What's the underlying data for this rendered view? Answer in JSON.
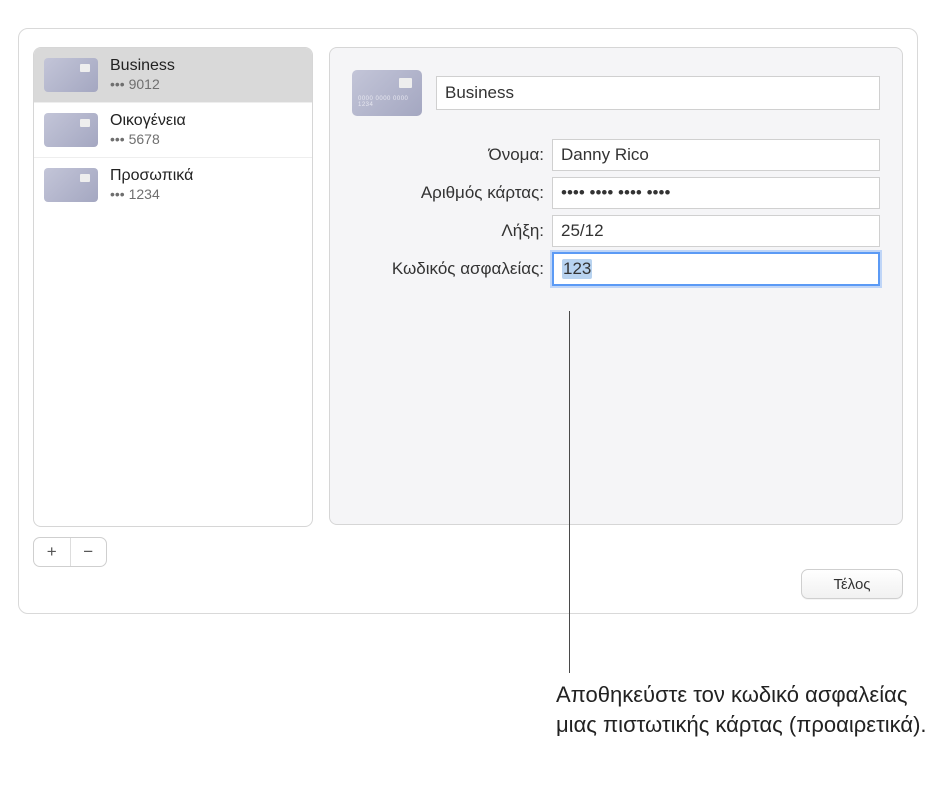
{
  "sidebar": {
    "cards": [
      {
        "name": "Business",
        "mask": "••• 9012",
        "selected": true
      },
      {
        "name": "Οικογένεια",
        "mask": "••• 5678",
        "selected": false
      },
      {
        "name": "Προσωπικά",
        "mask": "••• 1234",
        "selected": false
      }
    ]
  },
  "detail": {
    "title": "Business",
    "fields": {
      "name": {
        "label": "Όνομα:",
        "value": "Danny Rico"
      },
      "number": {
        "label": "Αριθμός κάρτας:",
        "value": "•••• •••• •••• ••••"
      },
      "expiry": {
        "label": "Λήξη:",
        "value": "25/12"
      },
      "cvv": {
        "label": "Κωδικός ασφαλείας:",
        "value": "123",
        "focused": true
      }
    }
  },
  "buttons": {
    "add": "+",
    "remove": "−",
    "done": "Τέλος"
  },
  "callout": "Αποθηκεύστε τον κωδικό ασφαλείας μιας πιστωτικής κάρτας (προαιρετικά)."
}
